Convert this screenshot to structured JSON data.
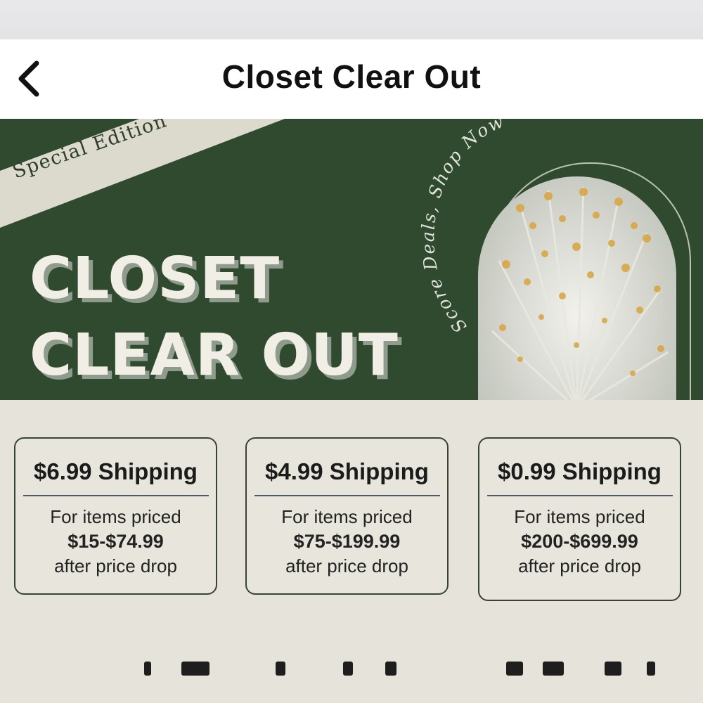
{
  "nav": {
    "title": "Closet Clear Out",
    "back_icon": "chevron-left-icon"
  },
  "banner": {
    "ribbon_text": "Special Edition",
    "headline_line1": "CLOSET",
    "headline_line2": "CLEAR OUT",
    "arch_caption": "Score Deals, Shop Now",
    "colors": {
      "background": "#304a2f",
      "ribbon": "#dcd9cd",
      "headline": "#f1eee6"
    }
  },
  "shipping_tiers": [
    {
      "price_label": "$6.99 Shipping",
      "line1": "For items priced",
      "range": "$15-$74.99",
      "line3": "after price drop"
    },
    {
      "price_label": "$4.99 Shipping",
      "line1": "For items priced",
      "range": "$75-$199.99",
      "line3": "after price drop"
    },
    {
      "price_label": "$0.99 Shipping",
      "line1": "For items priced",
      "range": "$200-$699.99",
      "line3": "after price drop"
    }
  ]
}
